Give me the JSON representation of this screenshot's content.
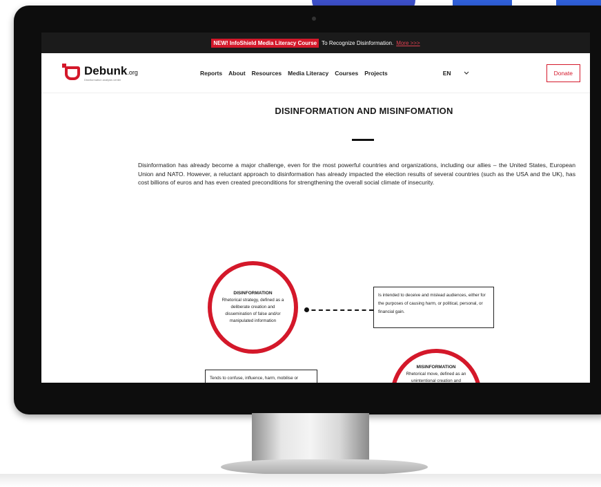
{
  "announcement": {
    "highlight": "NEW! InfoShield Media Literacy Course",
    "text": "To Recognize Disinformation.",
    "link": "More >>>"
  },
  "logo": {
    "name": "Debunk",
    "suffix": ".org",
    "tagline": "Disinformation analysis center"
  },
  "nav": {
    "items": [
      "Reports",
      "About",
      "Resources",
      "Media Literacy",
      "Courses",
      "Projects"
    ],
    "language": "EN",
    "donate": "Donate"
  },
  "main": {
    "title": "DISINFORMATION AND MISINFOMATION",
    "intro": "Disinformation has already become a major challenge, even for the most powerful countries and organizations, including our allies – the United States, European Union and NATO. However, a reluctant approach to disinformation has already impacted the election results of several countries (such as the USA and the UK), has cost billions of euros and has even created preconditions for strengthening the overall social climate of insecurity."
  },
  "diagram": {
    "disinformation": {
      "title": "DISINFORMATION",
      "text": "Rhetorical strategy, defined as a deliberate creation and dissemination of false and/or manipulated information",
      "box": "Is intended to deceive and mislead audiences, either for the purposes of causing harm, or political, personal, or financial gain."
    },
    "misinformation": {
      "title": "MISINFORMATION",
      "text": "Rhetorical move, defined as an unintentional creation and dissemination of false or misleading",
      "box": "Tends to confuse, influence, harm, mobilise or demobilise an audience."
    }
  },
  "colors": {
    "brand_red": "#d4182a",
    "topbar": "#1b1b1b",
    "bezel": "#0d0d0d"
  }
}
